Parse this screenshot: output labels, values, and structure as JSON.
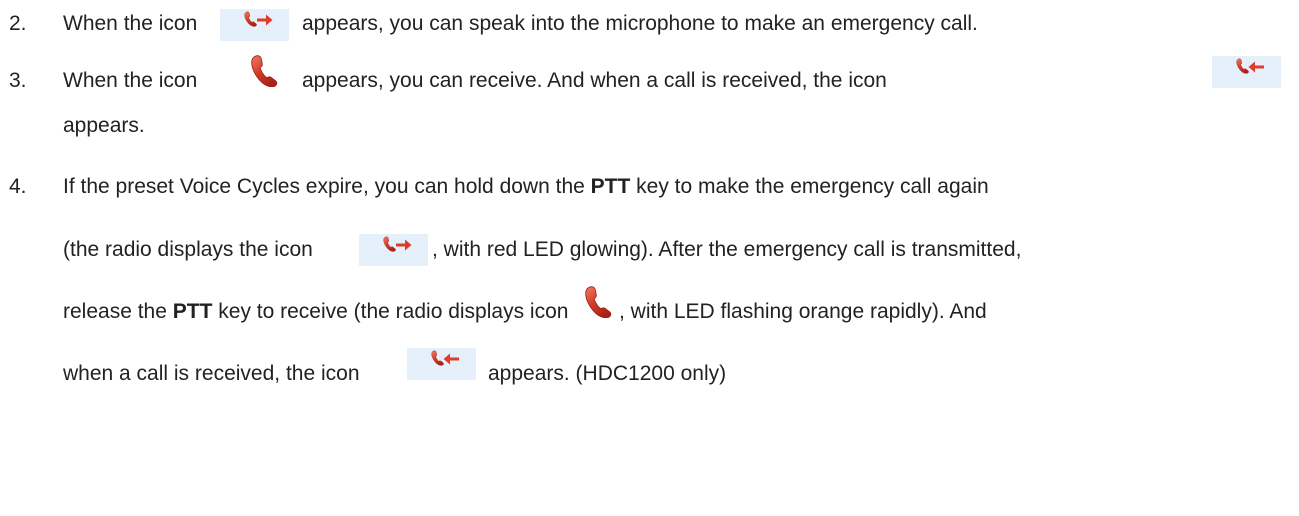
{
  "items": [
    {
      "number": "2.",
      "p1": "When the icon",
      "p2": "appears, you can speak into the microphone to make an emergency call."
    },
    {
      "number": "3.",
      "p1": "When the icon",
      "p2": "appears, you can receive. And when a call is received, the icon",
      "p3": "appears."
    },
    {
      "number": "4.",
      "l1a": "If the preset Voice Cycles expire, you can hold down the",
      "l1b": "PTT",
      "l1c": "key to make the emergency call again",
      "l2a": "(the radio displays the icon",
      "l2b": ", with red LED glowing). After the emergency call is transmitted,",
      "l3a": "release the",
      "l3b": "PTT",
      "l3c": "key to receive (the radio displays icon",
      "l3d": ", with LED flashing orange rapidly). And",
      "l4a": "when a call is received, the icon",
      "l4b": "appears. (HDC1200 only)"
    }
  ],
  "icons": {
    "transmit": "call-transmit-icon",
    "idle": "call-idle-icon",
    "receive": "call-receive-icon"
  },
  "colors": {
    "text": "#222222",
    "chip_bg": "#e6f0fa",
    "handset": "#cc3a2a",
    "arrow": "#e23b2b"
  }
}
